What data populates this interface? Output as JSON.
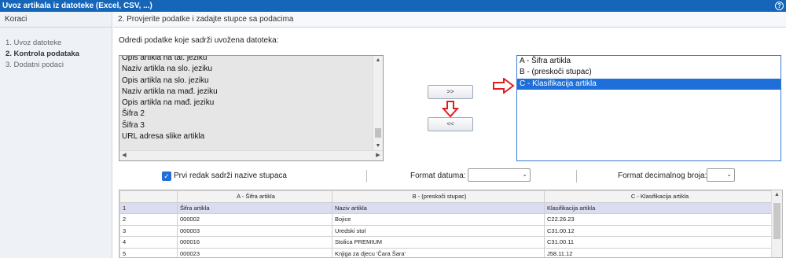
{
  "window": {
    "title": "Uvoz artikala iz datoteke (Excel, CSV, ...)",
    "help_icon": "?"
  },
  "sidebar": {
    "title": "Koraci",
    "steps": [
      {
        "label": "1. Uvoz datoteke",
        "active": false
      },
      {
        "label": "2. Kontrola podataka",
        "active": true
      },
      {
        "label": "3. Dodatni podaci",
        "active": false
      }
    ]
  },
  "main": {
    "title": "2. Provjerite podatke i zadajte stupce sa podacima",
    "instruction": "Odredi podatke koje sadrži uvožena datoteka:"
  },
  "source_list": {
    "items": [
      "Opis artikla na tal. jeziku",
      "Naziv artikla na slo. jeziku",
      "Opis artikla na slo. jeziku",
      "Naziv artikla na mađ. jeziku",
      "Opis artikla na mađ. jeziku",
      "Šifra 2",
      "Šifra 3",
      "URL adresa slike artikla"
    ]
  },
  "buttons": {
    "add": ">>",
    "remove": "<<"
  },
  "target_list": {
    "items": [
      {
        "label": "A - Šifra artikla",
        "selected": false
      },
      {
        "label": "B - (preskoči stupac)",
        "selected": false
      },
      {
        "label": "C - Klasifikacija artikla",
        "selected": true
      }
    ]
  },
  "options": {
    "first_row_header_label": "Prvi redak sadrži nazive stupaca",
    "first_row_header_checked": true,
    "date_format_label": "Format datuma:",
    "date_format_value": "",
    "decimal_format_label": "Format decimalnog broja:",
    "decimal_format_value": ""
  },
  "grid": {
    "columns": [
      "",
      "A - Šifra artikla",
      "B - (preskoči stupac)",
      "C - Klasifikacija artikla"
    ],
    "rows": [
      [
        "1",
        "Šifra artikla",
        "Naziv artikla",
        "Klasifikacija artikla"
      ],
      [
        "2",
        "000002",
        "Bojice",
        "C22.26.23"
      ],
      [
        "3",
        "000003",
        "Uredski stol",
        "C31.00.12"
      ],
      [
        "4",
        "000016",
        "Stolica PREMIUM",
        "C31.00.11"
      ],
      [
        "5",
        "000023",
        "Knjiga za djecu 'Čara Šara'",
        "J58.11.12"
      ]
    ]
  },
  "colors": {
    "titlebar": "#1565b8",
    "selection": "#1e6fd9",
    "red_arrow": "#e02020"
  }
}
